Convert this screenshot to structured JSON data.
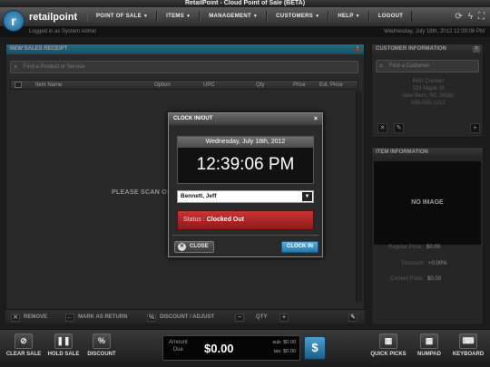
{
  "window": {
    "title": "RetailPoint - Cloud Point of Sale (BETA)"
  },
  "nav": {
    "logo_text": "retailpoint",
    "items": [
      {
        "label": "POINT OF SALE"
      },
      {
        "label": "ITEMS"
      },
      {
        "label": "MANAGEMENT"
      },
      {
        "label": "CUSTOMERS"
      },
      {
        "label": "HELP"
      },
      {
        "label": "LOGOUT"
      }
    ],
    "icons": [
      "refresh-icon",
      "lightning-icon",
      "fullscreen-icon"
    ]
  },
  "infobar": {
    "logged_in": "Logged in as System Admin",
    "datetime": "Wednesday, July 18th, 2012 12:39:06 PM"
  },
  "sales": {
    "header": "NEW SALES RECEIPT",
    "help": "?",
    "search_placeholder": "Find a Product or Service",
    "columns": [
      "Item Name",
      "Option",
      "UPC",
      "Qty",
      "Price",
      "Ext. Price"
    ],
    "scan_text": "PLEASE SCAN OR",
    "actions": {
      "remove": "REMOVE",
      "return": "MARK AS RETURN",
      "discount": "DISCOUNT / ADJUST",
      "qty": "QTY"
    }
  },
  "customer": {
    "header": "CUSTOMER INFORMATION",
    "help": "?",
    "search_placeholder": "Find a Customer",
    "name": "Rich Comber",
    "address1": "123 Maple St",
    "address2": "New Bern, NC 28562",
    "phone": "555-555-1212"
  },
  "item_info": {
    "header": "ITEM INFORMATION",
    "no_image": "NO IMAGE",
    "regular_price_label": "Regular Price:",
    "regular_price": "$0.00",
    "discount_label": "Discount:",
    "discount": "+0.00%",
    "current_price_label": "Current Price:",
    "current_price": "$0.00"
  },
  "footer": {
    "clear_sale": "CLEAR SALE",
    "hold_sale": "HOLD SALE",
    "discount": "DISCOUNT",
    "amount_label": "Amount",
    "due_label": "Due",
    "amount": "$0.00",
    "sub": "sub: $0.00",
    "tax": "tax: $0.00",
    "quick_picks": "QUICK PICKS",
    "numpad": "NUMPAD",
    "keyboard": "KEYBOARD"
  },
  "modal": {
    "title": "CLOCK IN/OUT",
    "close_x": "×",
    "date": "Wednesday, July 18th, 2012",
    "time": "12:39:06 PM",
    "employee": "Bennett, Jeff",
    "status_label": "Status :",
    "status_value": "Clocked Out",
    "close_button": "CLOSE",
    "clock_in_button": "CLOCK IN"
  },
  "colors": {
    "accent_blue": "#2a8fb3",
    "status_red": "#b02626",
    "clock_in_blue": "#3a92c8"
  }
}
